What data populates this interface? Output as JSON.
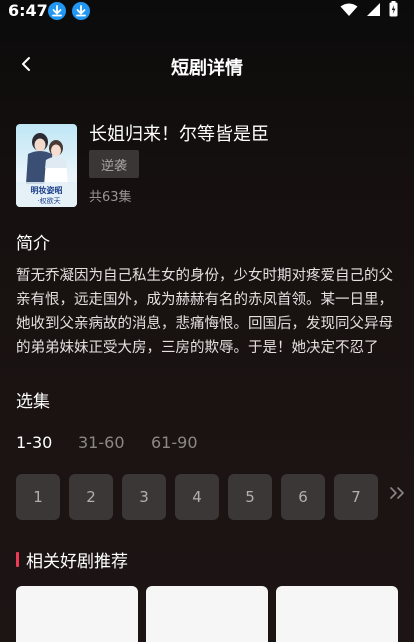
{
  "status_bar": {
    "time": "6:47",
    "icons": [
      "download-icon",
      "download-icon",
      "wifi-icon",
      "signal-icon",
      "battery-icon"
    ]
  },
  "header": {
    "title": "短剧详情",
    "back_icon": "chevron-left-icon"
  },
  "drama": {
    "title": "长姐归来！尔等皆是臣",
    "tag": "逆袭",
    "episodes": "共63集",
    "poster_text": "明妆姿昭·权欲天"
  },
  "intro": {
    "heading": "简介",
    "text": "暂无乔凝因为自己私生女的身份，少女时期对疼爱自己的父亲有恨，远走国外，成为赫赫有名的赤凤首领。某一日里，她收到父亲病故的消息，悲痛悔恨。回国后，发现同父异母的弟弟妹妹正受大房，三房的欺辱。于是！她决定不忍了"
  },
  "episodes": {
    "heading": "选集",
    "ranges": [
      "1-30",
      "31-60",
      "61-90"
    ],
    "active_range": "1-30",
    "items": [
      "1",
      "2",
      "3",
      "4",
      "5",
      "6",
      "7"
    ],
    "more_icon": "double-chevron-right-icon"
  },
  "recommend": {
    "heading": "相关好剧推荐",
    "accent": "#ee3b55"
  },
  "colors": {
    "background": "#120d0c",
    "tag_bg": "#3a3636",
    "episode_bg": "#3a3736",
    "status_icon_blue": "#2196f3"
  }
}
